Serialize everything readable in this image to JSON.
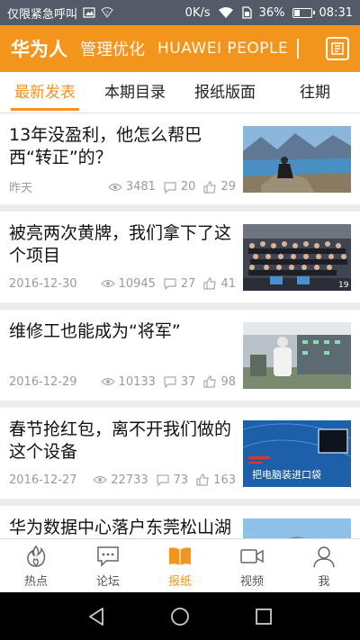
{
  "status_bar": {
    "left_text": "仅限紧急呼叫",
    "speed": "0K/s",
    "battery": "36%",
    "time": "08:31",
    "battery_level": 0.36
  },
  "header": {
    "brand": "华为人",
    "subtitle": "管理优化",
    "subtitle_en": "HUAWEI PEOPLE",
    "right_icon": "newspaper-icon"
  },
  "tabs": [
    {
      "label": "最新发表",
      "active": true
    },
    {
      "label": "本期目录",
      "active": false
    },
    {
      "label": "报纸版面",
      "active": false
    },
    {
      "label": "往期",
      "active": false
    }
  ],
  "articles": [
    {
      "title": "13年没盈利，他怎么帮巴西“转正”的？",
      "date": "昨天",
      "views": "3481",
      "comments": "20",
      "likes": "29",
      "thumb": "lake-landscape"
    },
    {
      "title": "被亮两次黄牌，我们拿下了这个项目",
      "date": "2016-12-30",
      "views": "10945",
      "comments": "27",
      "likes": "41",
      "thumb": "team-photo",
      "thumb_badge": "19"
    },
    {
      "title": "维修工也能成为“将军”",
      "date": "2016-12-29",
      "views": "10133",
      "comments": "37",
      "likes": "98",
      "thumb": "factory-worker"
    },
    {
      "title": "春节抢红包，离不开我们做的这个设备",
      "date": "2016-12-27",
      "views": "22733",
      "comments": "73",
      "likes": "163",
      "thumb": "blue-device",
      "thumb_caption": "把电脑装进口袋"
    },
    {
      "title": "华为数据中心落户东莞松山湖",
      "date": "",
      "views": "",
      "comments": "",
      "likes": "",
      "thumb": "building"
    }
  ],
  "bottom_nav": [
    {
      "label": "热点",
      "icon": "flame-icon",
      "active": false
    },
    {
      "label": "论坛",
      "icon": "chat-icon",
      "active": false
    },
    {
      "label": "报纸",
      "icon": "book-icon",
      "active": true
    },
    {
      "label": "视频",
      "icon": "video-icon",
      "active": false
    },
    {
      "label": "我",
      "icon": "person-icon",
      "active": false
    }
  ],
  "colors": {
    "accent": "#f3941c",
    "status_bar": "#555a68"
  }
}
